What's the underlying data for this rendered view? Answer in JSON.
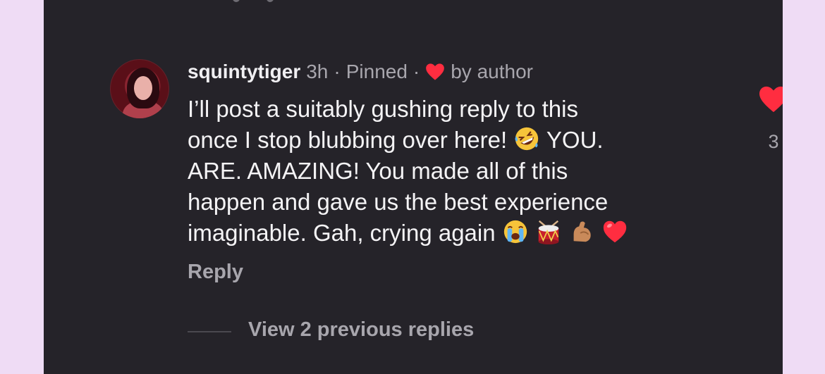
{
  "comment": {
    "username": "squintytiger",
    "time": "3h",
    "separator_1": "·",
    "pinned_label": "Pinned",
    "separator_2": "·",
    "liked_by_label": "by author",
    "text_line_1": "I’ll post a suitably gushing reply to this",
    "text_line_2a": "once I stop blubbing over here!",
    "text_line_2b": "YOU.",
    "text_line_3": "ARE. AMAZING! You made all of this",
    "text_line_4": "happen and gave us the best experience",
    "text_line_5": "imaginable. Gah, crying again",
    "emojis": [
      "rolling-on-floor-laughing",
      "loudly-crying-face",
      "drum",
      "flexed-biceps",
      "red-heart"
    ],
    "reply_label": "Reply",
    "like_count": "3"
  },
  "thread": {
    "view_replies_label": "View 2 previous replies"
  },
  "colors": {
    "background": "#efdcf5",
    "card": "#252329",
    "heart_red": "#ff2d40",
    "text_primary": "#f4f3f5",
    "text_secondary": "#a8a6ad"
  }
}
